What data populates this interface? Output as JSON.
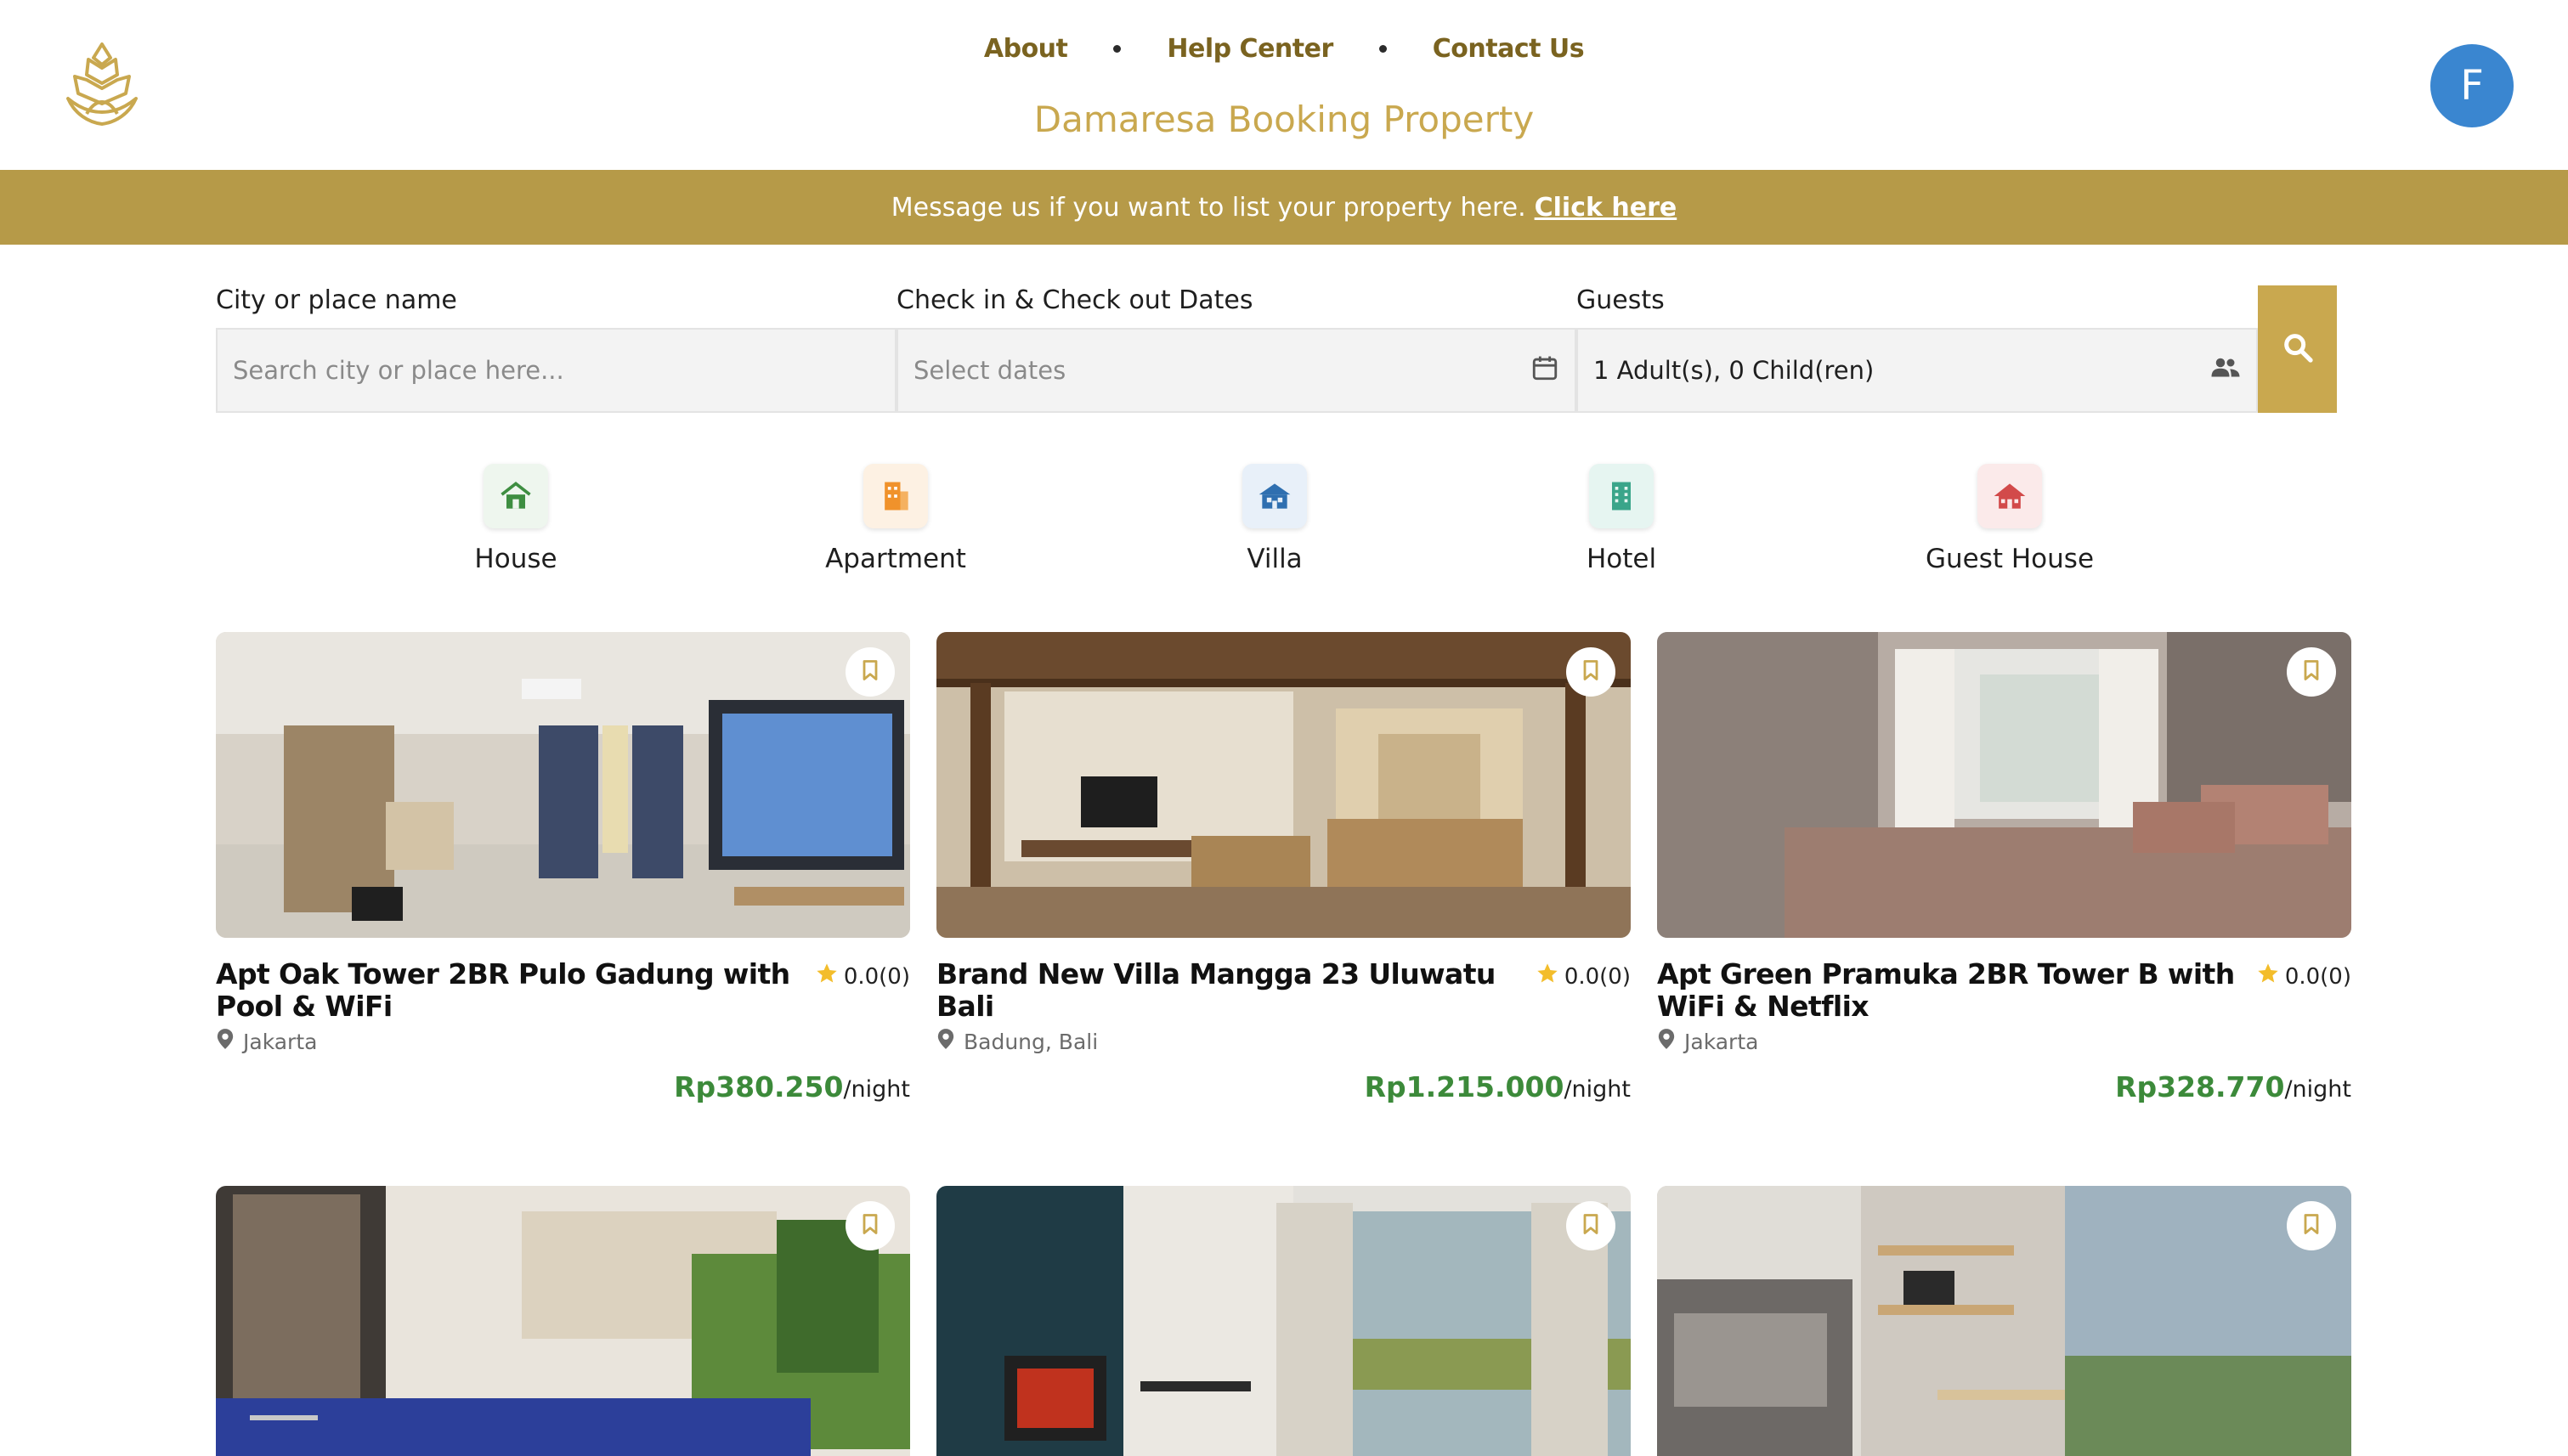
{
  "nav": {
    "items": [
      "About",
      "Help Center",
      "Contact Us"
    ],
    "brand": "Damaresa Booking Property",
    "avatar_initial": "F"
  },
  "banner": {
    "message": "Message us if you want to list your property here.",
    "link_text": "Click here"
  },
  "search": {
    "city_label": "City or place name",
    "city_placeholder": "Search city or place here...",
    "dates_label": "Check in & Check out Dates",
    "dates_placeholder": "Select dates",
    "guests_label": "Guests",
    "guests_value": "1 Adult(s), 0 Child(ren)"
  },
  "categories": [
    {
      "label": "House",
      "icon": "house-icon",
      "color": "#3e8e41"
    },
    {
      "label": "Apartment",
      "icon": "apartment-icon",
      "color": "#f0922b"
    },
    {
      "label": "Villa",
      "icon": "villa-icon",
      "color": "#2f6fb0"
    },
    {
      "label": "Hotel",
      "icon": "hotel-icon",
      "color": "#3aa58a"
    },
    {
      "label": "Guest House",
      "icon": "guest-house-icon",
      "color": "#d24a4a"
    }
  ],
  "listings": [
    {
      "title": "Apt Oak Tower 2BR Pulo Gadung with Pool & WiFi",
      "rating": "0.0(0)",
      "location": "Jakarta",
      "price": "Rp380.250",
      "unit": "/night"
    },
    {
      "title": "Brand New Villa Mangga 23 Uluwatu Bali",
      "rating": "0.0(0)",
      "location": "Badung, Bali",
      "price": "Rp1.215.000",
      "unit": "/night"
    },
    {
      "title": "Apt Green Pramuka 2BR Tower B with WiFi & Netflix",
      "rating": "0.0(0)",
      "location": "Jakarta",
      "price": "Rp328.770",
      "unit": "/night"
    }
  ],
  "colors": {
    "accent_gold": "#c9a84f",
    "banner_gold": "#b69a48",
    "nav_brown": "#7a6320",
    "price_green": "#3c8a3a",
    "avatar_blue": "#3a86d0"
  }
}
